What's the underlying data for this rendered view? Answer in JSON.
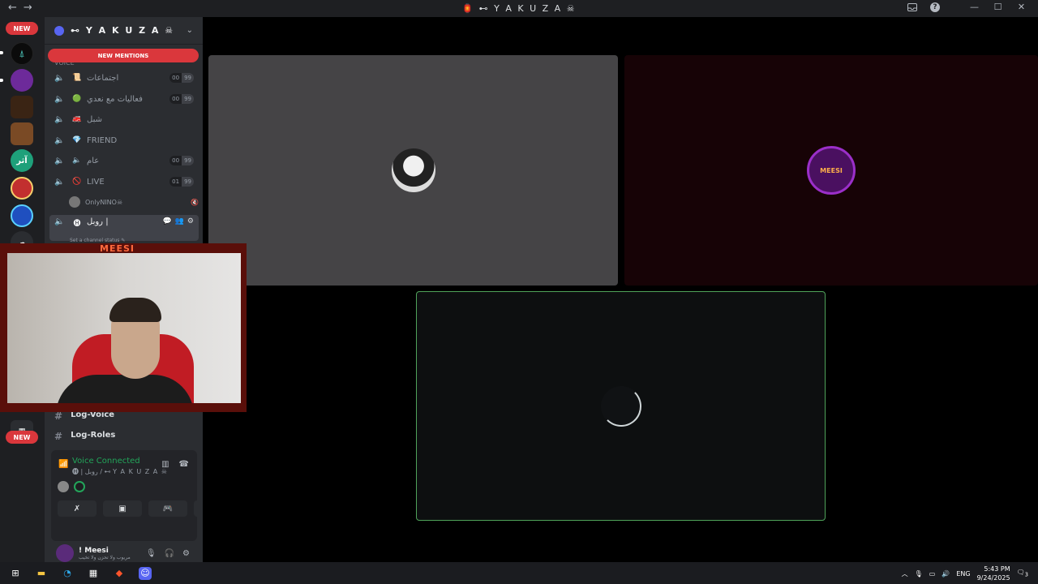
{
  "window": {
    "title": "🏮 ⊷ Y A K U Z A ☠",
    "back": "←",
    "forward": "→",
    "icons": [
      "inbox-icon",
      "help-icon",
      "minimize-icon",
      "maximize-icon",
      "close-icon"
    ],
    "help_glyph": "?",
    "minimize_glyph": "—",
    "maximize_glyph": "☐",
    "close_glyph": "✕"
  },
  "guilds": {
    "new_top": "NEW",
    "new_bottom": "NEW",
    "colors": [
      "#0b0b0b",
      "#6d2a9a",
      "#3a2414",
      "#7a4a25",
      "#1ea07a",
      "#c22f2f",
      "#1f4fbf"
    ]
  },
  "server": {
    "name": "⊷ Y A K U Z A ☠",
    "new_mentions": "NEW MENTIONS",
    "category": "VOICE",
    "channels": [
      {
        "emoji": "📜",
        "label": "اجتماعات",
        "count_a": "00",
        "count_b": "99"
      },
      {
        "emoji": "🟢",
        "label": "فعاليات مع نعدي",
        "count_a": "00",
        "count_b": "99"
      },
      {
        "emoji": "🚒",
        "label": "شبل",
        "count_a": "",
        "count_b": ""
      },
      {
        "emoji": "💎",
        "label": "FRIEND",
        "count_a": "",
        "count_b": ""
      },
      {
        "emoji": "🔈",
        "label": "عام",
        "count_a": "00",
        "count_b": "99"
      },
      {
        "emoji": "🚫",
        "label": "LIVE",
        "count_a": "01",
        "count_b": "99"
      }
    ],
    "member": {
      "name": "OnlyNINO☠",
      "status": "🔇"
    },
    "active_channel": {
      "emoji": "🅗",
      "label": "روبل |",
      "status_text": "Set a channel status ✎"
    },
    "text_channels": [
      "Log-Voice",
      "Log-Roles"
    ]
  },
  "voice": {
    "status": "Voice Connected",
    "location": "🅗 | روبل / ⊷ Y A K U Z A ☠",
    "button_icons": [
      "camera-off",
      "screen-share",
      "activity",
      "soundboard"
    ]
  },
  "user": {
    "name": "! Meesi",
    "status": "مريوب ولا تحزن ولا تخيب",
    "mic_glyph": "🎙",
    "headset_glyph": "🎧",
    "settings_glyph": "⚙"
  },
  "stage": {
    "tile_logo_text": "MEESI",
    "webcam_tag": "MEESI"
  },
  "taskbar": {
    "lang": "ENG",
    "time": "5:43 PM",
    "date": "9/24/2025",
    "notif_count": "3"
  }
}
